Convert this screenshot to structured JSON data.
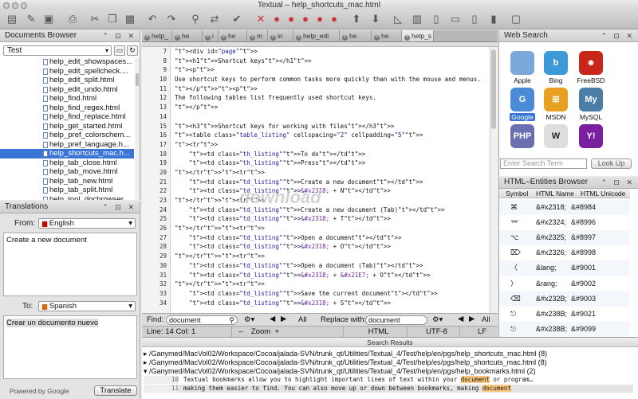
{
  "window": {
    "title": "Textual – help_shortcuts_mac.html"
  },
  "docs": {
    "title": "Documents Browser",
    "selector": "Test",
    "files": [
      "help_edit_showspaces...",
      "help_edit_spellcheck....",
      "help_edit_split.html",
      "help_edit_undo.html",
      "help_find.html",
      "help_find_regex.html",
      "help_find_replace.html",
      "help_get_started.html",
      "help_pref_colorschem...",
      "help_pref_language.h...",
      "help_shortcuts_mac.h...",
      "help_tab_close.html",
      "help_tab_move.html",
      "help_tab_new.html",
      "help_tab_split.html",
      "help_tool_dochrowser..."
    ],
    "selected_index": 10
  },
  "translations": {
    "title": "Translations",
    "from_label": "From:",
    "from_lang": "English",
    "source_text": "Create a new document",
    "to_label": "To:",
    "to_lang": "Spanish",
    "result_text": "Crear un documento nuevo",
    "powered": "Powered by Google",
    "translate_btn": "Translate"
  },
  "editor": {
    "tabs": [
      "help_",
      "he",
      "i",
      "he",
      "m",
      "in",
      "help_edi",
      "he",
      "he",
      "help_s"
    ],
    "active_tab": 9,
    "line_numbers": [
      "7",
      "8",
      "9",
      "10",
      "11",
      "12",
      "13",
      "14",
      "15",
      "16",
      "17",
      "18",
      "19",
      "20",
      "21",
      "22",
      "23",
      "24",
      "25",
      "26",
      "27",
      "28",
      "29",
      "30",
      "31",
      "32",
      "33",
      "34"
    ],
    "lines": [
      "<div id=\"page\">",
      "<h1>Shortcut keys</h1>",
      "<p>",
      "Use shortcut keys to perform common tasks more quickly than with the mouse and menus.",
      "</p><p>",
      "The following tables list frequently used shortcut keys.",
      "</p>",
      "",
      "<h3>Shortcut keys for working with files</h3>",
      "<table class=\"table_listing\" cellspacing=\"2\" cellpadding=\"5\">",
      "<tr>",
      "    <td class=\"th_listing\">To do</td>",
      "    <td class=\"th_listing\">Press</td>",
      "</tr><tr>",
      "    <td class=\"td_listing\">Create a new document</td>",
      "    <td class=\"td_listing\">&#x2318; + N</td>",
      "</tr><tr>",
      "    <td class=\"td_listing\">Create a new document (Tab)</td>",
      "    <td class=\"td_listing\">&#x2318; + T</td>",
      "</tr><tr>",
      "    <td class=\"td_listing\">Open a document</td>",
      "    <td class=\"td_listing\">&#x2318; + O</td>",
      "</tr><tr>",
      "    <td class=\"td_listing\">Open a document (Tab)</td>",
      "    <td class=\"td_listing\">&#x2318; + &#x21E7; + O</td>",
      "</tr><tr>",
      "    <td class=\"td_listing\">Save the current document</td>",
      "    <td class=\"td_listing\">&#x2318; + S</td>"
    ],
    "watermark": "download"
  },
  "findbar": {
    "find_label": "Find:",
    "find_value": "document",
    "all1": "All",
    "replace_label": "Replace with:",
    "replace_value": "document",
    "all2": "All"
  },
  "status": {
    "position": "Line: 14 Col: 1",
    "zoom": "Zoom",
    "syntax": "HTML",
    "encoding": "UTF-8",
    "eol": "LF"
  },
  "web": {
    "title": "Web Search",
    "engines": [
      {
        "name": "Apple",
        "icon": "apple-icon",
        "color": "#7aa8d8",
        "glyph": ""
      },
      {
        "name": "Bing",
        "icon": "bing-icon",
        "color": "#3c9ad8",
        "glyph": "b"
      },
      {
        "name": "FreeBSD",
        "icon": "freebsd-icon",
        "color": "#c8261a",
        "glyph": "☻"
      },
      {
        "name": "Google",
        "icon": "google-icon",
        "color": "#4a8ad6",
        "glyph": "G"
      },
      {
        "name": "MSDN",
        "icon": "msdn-icon",
        "color": "#e8a020",
        "glyph": "⊞"
      },
      {
        "name": "MySQL",
        "icon": "mysql-icon",
        "color": "#4a7ea6",
        "glyph": "My"
      },
      {
        "name": "",
        "icon": "php-icon",
        "color": "#6a6fb0",
        "glyph": "PHP"
      },
      {
        "name": "",
        "icon": "wikipedia-icon",
        "color": "#dddddd",
        "glyph": "W"
      },
      {
        "name": "",
        "icon": "yahoo-icon",
        "color": "#7a1fa0",
        "glyph": "Y!"
      }
    ],
    "selected": 3,
    "search_placeholder": "Enter Search Term",
    "lookup": "Look Up"
  },
  "entities": {
    "title": "HTML–Entities Browser",
    "cols": [
      "Symbol",
      "HTML Name",
      "HTML Unicode"
    ],
    "rows": [
      {
        "sym": "⌘",
        "name": "&#x2318;",
        "uni": "&#8984"
      },
      {
        "sym": "⌤",
        "name": "&#x2324;",
        "uni": "&#8996"
      },
      {
        "sym": "⌥",
        "name": "&#x2325;",
        "uni": "&#8997"
      },
      {
        "sym": "⌦",
        "name": "&#x2326;",
        "uni": "&#8998"
      },
      {
        "sym": "〈",
        "name": "&lang;",
        "uni": "&#9001"
      },
      {
        "sym": "〉",
        "name": "&rang;",
        "uni": "&#9002"
      },
      {
        "sym": "⌫",
        "name": "&#x232B;",
        "uni": "&#9003"
      },
      {
        "sym": "⎋",
        "name": "&#x238B;",
        "uni": "&#9021"
      },
      {
        "sym": "⎋",
        "name": "&#x238B;",
        "uni": "&#9099"
      }
    ]
  },
  "results": {
    "title": "Search Results",
    "files": [
      "/Ganymed/MacVol02/Workspace/Cocoa/jalada-SVN/trunk_qt/Utilities/Textual_4/Test/help/en/pgs/help_shortcuts_mac.html (8)",
      "/Ganymed/MacVol02/Workspace/Cocoa/jalada-SVN/trunk_qt/Utilities/Textual_4/Test/help/es/pgs/help_shortcuts_mac.html (8)",
      "/Ganymed/MacVol02/Workspace/Cocoa/jalada-SVN/trunk_qt/Utilities/Textual_4/Test/help/en/pgs/help_bookmarks.html (2)"
    ],
    "hits": [
      {
        "line": "10",
        "pre": "Textual bookmarks allow you to highlight important lines of text within your ",
        "hit": "document",
        "post": " or program…"
      },
      {
        "line": "11",
        "pre": "making them easier to find. You can also move up or down between bookmarks, making ",
        "hit": "document",
        "post": ""
      }
    ]
  }
}
